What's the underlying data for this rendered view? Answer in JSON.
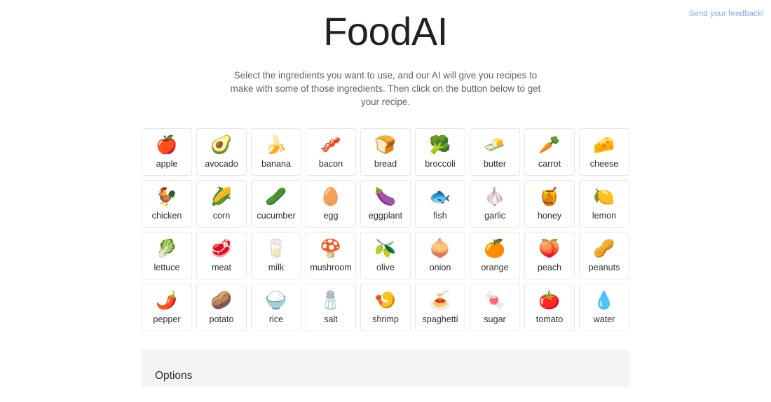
{
  "feedback": {
    "label": "Send your feedback!",
    "color": "#7ba7ef"
  },
  "header": {
    "title": "FoodAI",
    "subtitle": "Select the ingredients you want to use, and our AI will give you recipes to make with some of those ingredients. Then click on the button below to get your recipe."
  },
  "ingredients": [
    {
      "label": "apple",
      "emoji": "🍎",
      "icon": "apple-icon"
    },
    {
      "label": "avocado",
      "emoji": "🥑",
      "icon": "avocado-icon"
    },
    {
      "label": "banana",
      "emoji": "🍌",
      "icon": "banana-icon"
    },
    {
      "label": "bacon",
      "emoji": "🥓",
      "icon": "bacon-icon"
    },
    {
      "label": "bread",
      "emoji": "🍞",
      "icon": "bread-icon"
    },
    {
      "label": "broccoli",
      "emoji": "🥦",
      "icon": "broccoli-icon"
    },
    {
      "label": "butter",
      "emoji": "🧈",
      "icon": "butter-icon"
    },
    {
      "label": "carrot",
      "emoji": "🥕",
      "icon": "carrot-icon"
    },
    {
      "label": "cheese",
      "emoji": "🧀",
      "icon": "cheese-icon"
    },
    {
      "label": "chicken",
      "emoji": "🐓",
      "icon": "chicken-icon"
    },
    {
      "label": "corn",
      "emoji": "🌽",
      "icon": "corn-icon"
    },
    {
      "label": "cucumber",
      "emoji": "🥒",
      "icon": "cucumber-icon"
    },
    {
      "label": "egg",
      "emoji": "🥚",
      "icon": "egg-icon"
    },
    {
      "label": "eggplant",
      "emoji": "🍆",
      "icon": "eggplant-icon"
    },
    {
      "label": "fish",
      "emoji": "🐟",
      "icon": "fish-icon"
    },
    {
      "label": "garlic",
      "emoji": "🧄",
      "icon": "garlic-icon"
    },
    {
      "label": "honey",
      "emoji": "🍯",
      "icon": "honey-icon"
    },
    {
      "label": "lemon",
      "emoji": "🍋",
      "icon": "lemon-icon"
    },
    {
      "label": "lettuce",
      "emoji": "🥬",
      "icon": "lettuce-icon"
    },
    {
      "label": "meat",
      "emoji": "🥩",
      "icon": "meat-icon"
    },
    {
      "label": "milk",
      "emoji": "🥛",
      "icon": "milk-icon"
    },
    {
      "label": "mushroom",
      "emoji": "🍄",
      "icon": "mushroom-icon"
    },
    {
      "label": "olive",
      "emoji": "🫒",
      "icon": "olive-icon"
    },
    {
      "label": "onion",
      "emoji": "🧅",
      "icon": "onion-icon"
    },
    {
      "label": "orange",
      "emoji": "🍊",
      "icon": "orange-icon"
    },
    {
      "label": "peach",
      "emoji": "🍑",
      "icon": "peach-icon"
    },
    {
      "label": "peanuts",
      "emoji": "🥜",
      "icon": "peanuts-icon"
    },
    {
      "label": "pepper",
      "emoji": "🌶️",
      "icon": "pepper-icon"
    },
    {
      "label": "potato",
      "emoji": "🥔",
      "icon": "potato-icon"
    },
    {
      "label": "rice",
      "emoji": "🍚",
      "icon": "rice-icon"
    },
    {
      "label": "salt",
      "emoji": "🧂",
      "icon": "salt-icon"
    },
    {
      "label": "shrimp",
      "emoji": "🍤",
      "icon": "shrimp-icon"
    },
    {
      "label": "spaghetti",
      "emoji": "🍝",
      "icon": "spaghetti-icon"
    },
    {
      "label": "sugar",
      "emoji": "🍬",
      "icon": "sugar-icon"
    },
    {
      "label": "tomato",
      "emoji": "🍅",
      "icon": "tomato-icon"
    },
    {
      "label": "water",
      "emoji": "💧",
      "icon": "water-icon"
    }
  ],
  "options": {
    "title": "Options"
  }
}
